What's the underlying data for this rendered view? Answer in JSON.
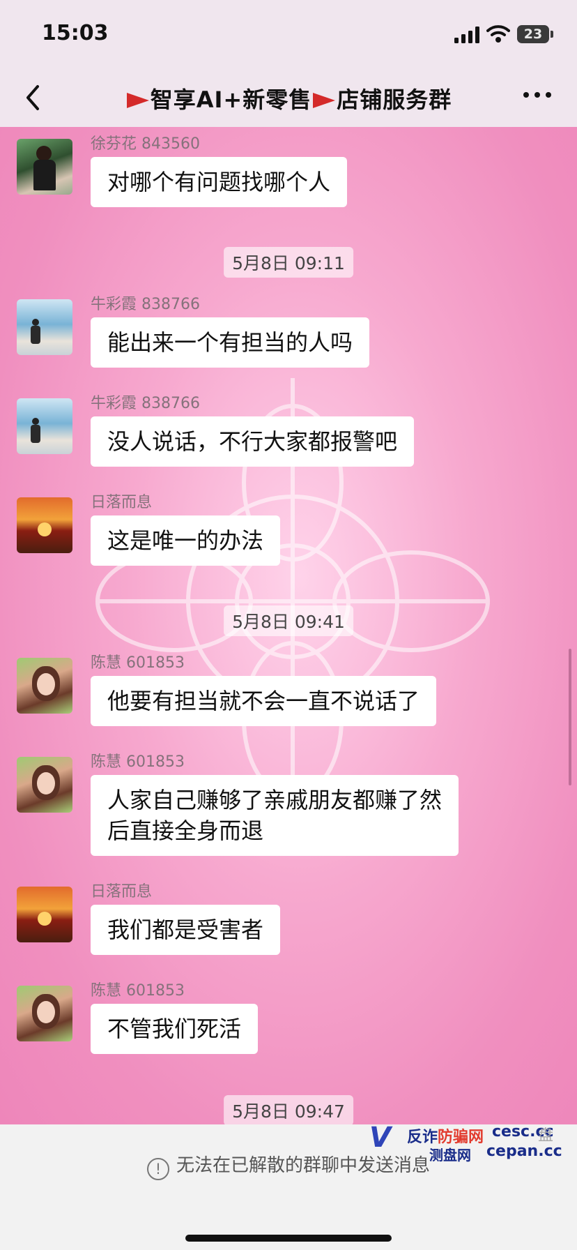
{
  "status_bar": {
    "time": "15:03",
    "battery": "23"
  },
  "header": {
    "title_part1": "智享AI+新零售",
    "title_part2": "店铺服务群"
  },
  "messages": [
    {
      "name": "徐芬花 843560",
      "text": "对哪个有问题找哪个人"
    },
    {
      "timestamp": "5月8日 09:11"
    },
    {
      "name": "牛彩霞 838766",
      "text": "能出来一个有担当的人吗"
    },
    {
      "name": "牛彩霞 838766",
      "text": "没人说话，不行大家都报警吧"
    },
    {
      "name": "日落而息",
      "text": "这是唯一的办法"
    },
    {
      "timestamp": "5月8日 09:41"
    },
    {
      "name": "陈慧 601853",
      "text": "他要有担当就不会一直不说话了"
    },
    {
      "name": "陈慧 601853",
      "text_line1": "人家自己赚够了亲戚朋友都赚了然",
      "text_line2": "后直接全身而退"
    },
    {
      "name": "日落而息",
      "text": "我们都是受害者"
    },
    {
      "name": "陈慧 601853",
      "text": "不管我们死活"
    },
    {
      "timestamp": "5月8日 09:47"
    }
  ],
  "footer": {
    "notice": "无法在已解散的群聊中发送消息"
  },
  "watermark": {
    "logo": "V",
    "line1_a": "反诈",
    "line1_b": "防骗网",
    "line2": "测盘网",
    "domain1": "cesc.cc",
    "domain2": "cepan.cc",
    "faint": "盘"
  },
  "icons": {
    "back": "chevron-left-icon",
    "flag": "red-flag-icon",
    "more": "more-horizontal-icon",
    "info": "info-circle-icon"
  }
}
